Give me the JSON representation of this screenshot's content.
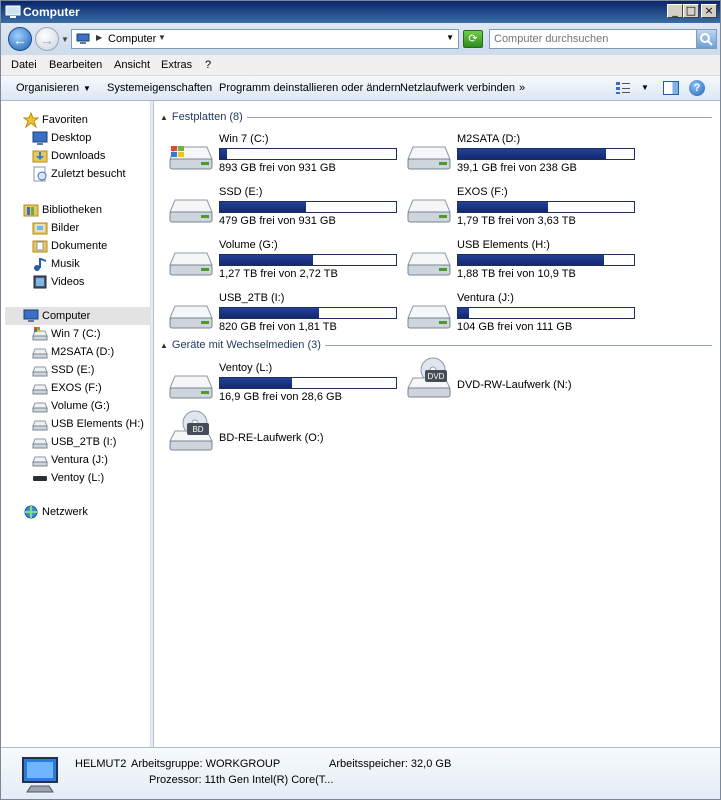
{
  "window": {
    "title": "Computer"
  },
  "titlebar_buttons": {
    "minimize": "_",
    "maximize": "□",
    "close": "×"
  },
  "address": {
    "breadcrumb": "Computer",
    "search_placeholder": "Computer durchsuchen"
  },
  "menu": [
    "Datei",
    "Bearbeiten",
    "Ansicht",
    "Extras",
    "?"
  ],
  "toolbar": {
    "organize": "Organisieren",
    "system_properties": "Systemeigenschaften",
    "uninstall": "Programm deinstallieren oder ändern",
    "map_drive": "Netzlaufwerk verbinden",
    "more": "»"
  },
  "nav": {
    "favorites": {
      "label": "Favoriten",
      "items": [
        "Desktop",
        "Downloads",
        "Zuletzt besucht"
      ]
    },
    "libraries": {
      "label": "Bibliotheken",
      "items": [
        "Bilder",
        "Dokumente",
        "Musik",
        "Videos"
      ]
    },
    "computer": {
      "label": "Computer",
      "items": [
        "Win 7 (C:)",
        "M2SATA (D:)",
        "SSD (E:)",
        "EXOS (F:)",
        "Volume (G:)",
        "USB Elements (H:)",
        "USB_2TB (I:)",
        "Ventura (J:)",
        "Ventoy (L:)"
      ]
    },
    "network": {
      "label": "Netzwerk"
    }
  },
  "groups": {
    "hard_disks": {
      "label": "Festplatten (8)",
      "drives": [
        {
          "name": "Win 7 (C:)",
          "free": "893 GB frei von 931 GB",
          "used_fraction": 0.04
        },
        {
          "name": "M2SATA (D:)",
          "free": "39,1 GB frei von 238 GB",
          "used_fraction": 0.84
        },
        {
          "name": "SSD (E:)",
          "free": "479 GB frei von 931 GB",
          "used_fraction": 0.49
        },
        {
          "name": "EXOS (F:)",
          "free": "1,79 TB frei von 3,63 TB",
          "used_fraction": 0.51
        },
        {
          "name": "Volume (G:)",
          "free": "1,27 TB frei von 2,72 TB",
          "used_fraction": 0.53
        },
        {
          "name": "USB Elements (H:)",
          "free": "1,88 TB frei von 10,9 TB",
          "used_fraction": 0.83
        },
        {
          "name": "USB_2TB (I:)",
          "free": "820 GB frei von 1,81 TB",
          "used_fraction": 0.56
        },
        {
          "name": "Ventura (J:)",
          "free": "104 GB frei von 111 GB",
          "used_fraction": 0.06
        }
      ]
    },
    "removable": {
      "label": "Geräte mit Wechselmedien (3)",
      "drives": [
        {
          "name": "Ventoy (L:)",
          "free": "16,9 GB frei von 28,6 GB",
          "used_fraction": 0.41
        },
        {
          "name": "DVD-RW-Laufwerk (N:)",
          "badge": "DVD"
        },
        {
          "name": "BD-RE-Laufwerk (O:)",
          "badge": "BD"
        }
      ]
    }
  },
  "details": {
    "computer_name": "HELMUT2",
    "workgroup": "Arbeitsgruppe: WORKGROUP",
    "memory": "Arbeitsspeicher: 32,0 GB",
    "processor": "Prozessor: 11th Gen Intel(R) Core(T..."
  }
}
